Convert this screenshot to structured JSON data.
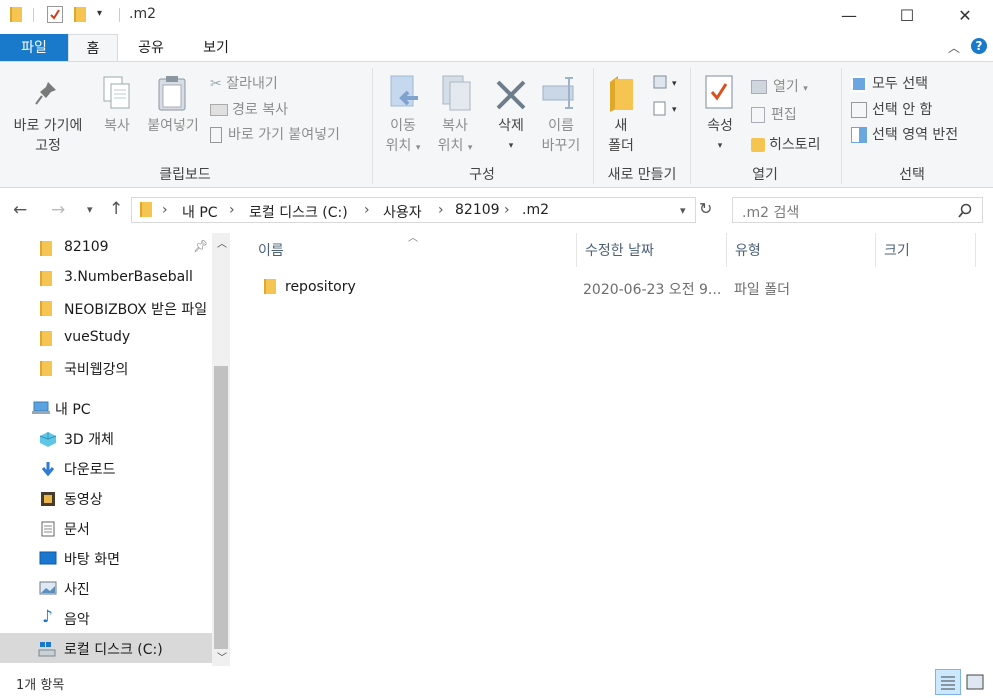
{
  "titlebar": {
    "path_title": ".m2",
    "minimize": "—",
    "maximize": "☐",
    "close": "✕"
  },
  "tabs": {
    "file": "파일",
    "home": "홈",
    "share": "공유",
    "view": "보기"
  },
  "ribbon": {
    "clipboard": {
      "pin_line1": "바로 가기에",
      "pin_line2": "고정",
      "copy": "복사",
      "paste": "붙여넣기",
      "cut": "잘라내기",
      "copy_path": "경로 복사",
      "paste_shortcut": "바로 가기 붙여넣기",
      "label": "클립보드"
    },
    "organize": {
      "move_line1": "이동",
      "move_line2": "위치",
      "copy_line1": "복사",
      "copy_line2": "위치",
      "delete": "삭제",
      "rename_line1": "이름",
      "rename_line2": "바꾸기",
      "label": "구성"
    },
    "new": {
      "folder_line1": "새",
      "folder_line2": "폴더",
      "label": "새로 만들기"
    },
    "open": {
      "properties": "속성",
      "open": "열기",
      "edit": "편집",
      "history": "히스토리",
      "label": "열기"
    },
    "select": {
      "select_all": "모두 선택",
      "select_none": "선택 안 함",
      "invert": "선택 영역 반전",
      "label": "선택"
    }
  },
  "address": {
    "crumbs": [
      "내 PC",
      "로컬 디스크 (C:)",
      "사용자",
      "82109",
      ".m2"
    ],
    "search_placeholder": ".m2 검색"
  },
  "nav": {
    "quick_access": [
      "82109",
      "3.NumberBaseball",
      "NEOBIZBOX 받은 파일",
      "vueStudy",
      "국비웹강의"
    ],
    "this_pc": "내 PC",
    "pc_items": [
      "3D 개체",
      "다운로드",
      "동영상",
      "문서",
      "바탕 화면",
      "사진",
      "음악",
      "로컬 디스크 (C:)"
    ]
  },
  "filelist": {
    "columns": {
      "name": "이름",
      "date": "수정한 날짜",
      "type": "유형",
      "size": "크기"
    },
    "rows": [
      {
        "name": "repository",
        "date": "2020-06-23 오전 9...",
        "type": "파일 폴더",
        "size": ""
      }
    ]
  },
  "status": {
    "count": "1개 항목"
  },
  "colors": {
    "accent": "#1979ca",
    "folder": "#f5c451",
    "selected_nav": "#cce8ff"
  }
}
